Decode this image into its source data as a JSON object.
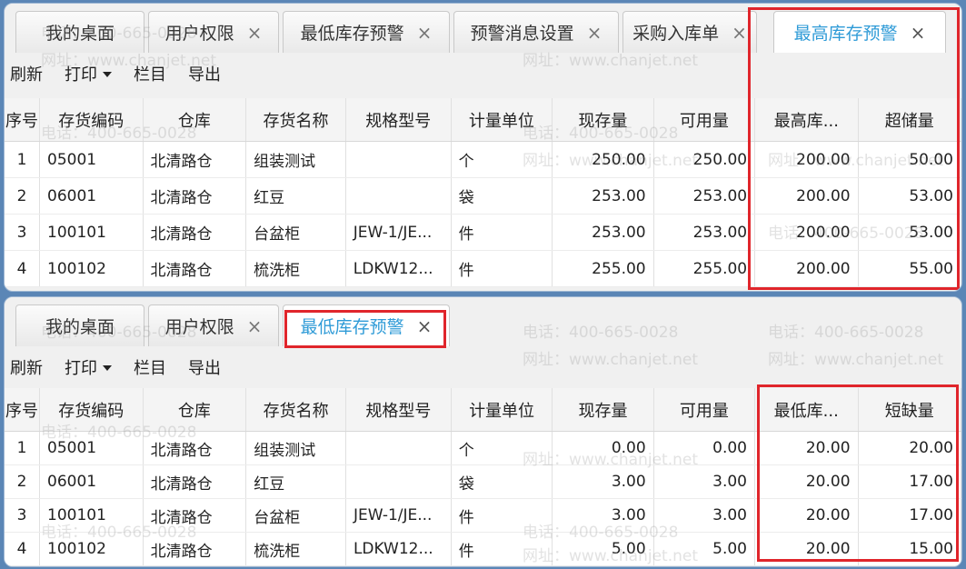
{
  "colors": {
    "active_tab": "#2f9bd7",
    "highlight": "#e0252b",
    "background": "#5b86b6"
  },
  "top_panel": {
    "tabs": [
      {
        "label": "我的桌面",
        "closable": false
      },
      {
        "label": "用户权限",
        "closable": true
      },
      {
        "label": "最低库存预警",
        "closable": true
      },
      {
        "label": "预警消息设置",
        "closable": true
      },
      {
        "label": "采购入库单",
        "closable": true
      },
      {
        "label": "最高库存预警",
        "closable": true,
        "active": true
      }
    ],
    "toolbar": {
      "refresh": "刷新",
      "print": "打印",
      "columns": "栏目",
      "export": "导出"
    },
    "columns": [
      "序号",
      "存货编码",
      "仓库",
      "存货名称",
      "规格型号",
      "计量单位",
      "现存量",
      "可用量",
      "最高库...",
      "超储量"
    ],
    "rows": [
      [
        "1",
        "05001",
        "北清路仓",
        "组装测试",
        "",
        "个",
        "250.00",
        "250.00",
        "200.00",
        "50.00"
      ],
      [
        "2",
        "06001",
        "北清路仓",
        "红豆",
        "",
        "袋",
        "253.00",
        "253.00",
        "200.00",
        "53.00"
      ],
      [
        "3",
        "100101",
        "北清路仓",
        "台盆柜",
        "JEW-1/JE...",
        "件",
        "253.00",
        "253.00",
        "200.00",
        "53.00"
      ],
      [
        "4",
        "100102",
        "北清路仓",
        "梳洗柜",
        "LDKW12...",
        "件",
        "255.00",
        "255.00",
        "200.00",
        "55.00"
      ]
    ]
  },
  "bottom_panel": {
    "tabs": [
      {
        "label": "我的桌面",
        "closable": false
      },
      {
        "label": "用户权限",
        "closable": true
      },
      {
        "label": "最低库存预警",
        "closable": true,
        "active": true
      }
    ],
    "toolbar": {
      "refresh": "刷新",
      "print": "打印",
      "columns": "栏目",
      "export": "导出"
    },
    "columns": [
      "序号",
      "存货编码",
      "仓库",
      "存货名称",
      "规格型号",
      "计量单位",
      "现存量",
      "可用量",
      "最低库...",
      "短缺量"
    ],
    "rows": [
      [
        "1",
        "05001",
        "北清路仓",
        "组装测试",
        "",
        "个",
        "0.00",
        "0.00",
        "20.00",
        "20.00"
      ],
      [
        "2",
        "06001",
        "北清路仓",
        "红豆",
        "",
        "袋",
        "3.00",
        "3.00",
        "20.00",
        "17.00"
      ],
      [
        "3",
        "100101",
        "北清路仓",
        "台盆柜",
        "JEW-1/JE...",
        "件",
        "3.00",
        "3.00",
        "20.00",
        "17.00"
      ],
      [
        "4",
        "100102",
        "北清路仓",
        "梳洗柜",
        "LDKW12...",
        "件",
        "5.00",
        "5.00",
        "20.00",
        "15.00"
      ]
    ]
  },
  "watermark": {
    "phone": "电话：400-665-0028",
    "site": "网址：www.chanjet.net"
  }
}
